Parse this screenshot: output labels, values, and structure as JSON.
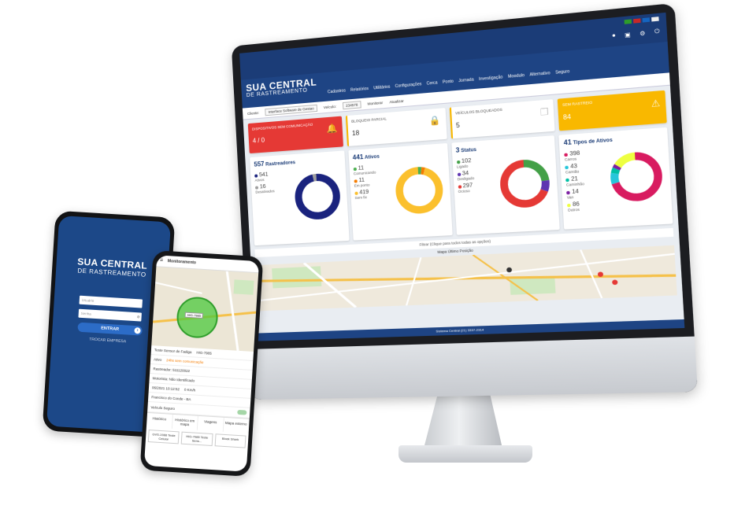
{
  "monitor": {
    "brand_line1": "SUA CENTRAL",
    "brand_line2": "DE RASTREAMENTO",
    "menu": [
      "Cadastros",
      "Relatórios",
      "Utilitários",
      "Configurações",
      "Cerca",
      "Ponto",
      "Jornada",
      "Investigação",
      "Moodulo",
      "Alternativo",
      "Seguro"
    ],
    "toolbar": {
      "client_label": "Cliente:",
      "client_value": "Interface Software de Gestao",
      "vehicle_label": "Veículo:",
      "vehicle_value": "234578",
      "monitor_button": "Monitorar",
      "refresh_button": "Atualizar"
    },
    "cards": [
      {
        "label": "Dispositivos sem comunicação",
        "value": "4 / 0"
      },
      {
        "label": "Bloqueio parcial",
        "value": "18"
      },
      {
        "label": "Veículos bloqueados",
        "value": "5"
      },
      {
        "label": "Sem rastreio",
        "value": "84"
      }
    ],
    "panels": [
      {
        "count": "557",
        "title": "Rastreadores",
        "legend": [
          {
            "value": "541",
            "label": "Ativos",
            "color": "#1a237e"
          },
          {
            "value": "16",
            "label": "Desativados",
            "color": "#9e9e9e"
          }
        ]
      },
      {
        "count": "441",
        "title": "Ativos",
        "legend": [
          {
            "value": "11",
            "label": "Comunicando",
            "color": "#4caf50"
          },
          {
            "value": "11",
            "label": "Em ponto",
            "color": "#f57c00"
          },
          {
            "value": "419",
            "label": "Sem fix",
            "color": "#fbc02d"
          }
        ]
      },
      {
        "count": "3",
        "title": "Status",
        "legend": [
          {
            "value": "102",
            "label": "Ligado",
            "color": "#43a047"
          },
          {
            "value": "34",
            "label": "Desligado",
            "color": "#5e35b1"
          },
          {
            "value": "297",
            "label": "Ocioso",
            "color": "#e53935"
          }
        ]
      },
      {
        "count": "41",
        "title": "Tipos de Ativos",
        "legend": [
          {
            "value": "398",
            "label": "Carros",
            "color": "#d81b60"
          },
          {
            "value": "43",
            "label": "Camião",
            "color": "#26c6da"
          },
          {
            "value": "21",
            "label": "Caminhão",
            "color": "#00bfa5"
          },
          {
            "value": "14",
            "label": "Van",
            "color": "#7b1fa2"
          },
          {
            "value": "86",
            "label": "Outros",
            "color": "#eeff41"
          }
        ]
      }
    ],
    "filter_text": "Filtrar (Clique para todos todas as opções)",
    "map_title": "Mapa Último Posição",
    "footer": "Sistema Central (21) 3337-2314",
    "colors": {
      "topbar": "#1b3c77",
      "brand": "#1e4484",
      "red": "#e53935",
      "yellow": "#f9b800"
    }
  },
  "phone_login": {
    "brand_line1": "SUA CENTRAL",
    "brand_line2": "DE RASTREAMENTO",
    "user_placeholder": "Usuário",
    "password_placeholder": "Senha",
    "login_button": "ENTRAR",
    "switch_company": "TROCAR EMPRESA"
  },
  "phone_monitor": {
    "header": "Monitoramento",
    "map_tag": "HIG-7985",
    "vehicle_name": "Teste Sensor de Fadiga",
    "plate": "HIG-7985",
    "ignition": "Ativo",
    "status": "24hs sem comunicação",
    "tracker": "Rastreador: 511120022",
    "driver": "Motorista: Não Identificado",
    "datetime": "06/2021 10:12:52",
    "speed": "0 Km/h",
    "address": "Francisco do Conde - BA",
    "secure": "Veículo Seguro",
    "tabs": [
      "Histórico",
      "Histórico em mapa",
      "Viagens",
      "Mapa externo"
    ],
    "chips": [
      "GVS-1988 Teste Celular",
      "HIG-7985 Teste Sens...",
      "Block Shark"
    ]
  }
}
